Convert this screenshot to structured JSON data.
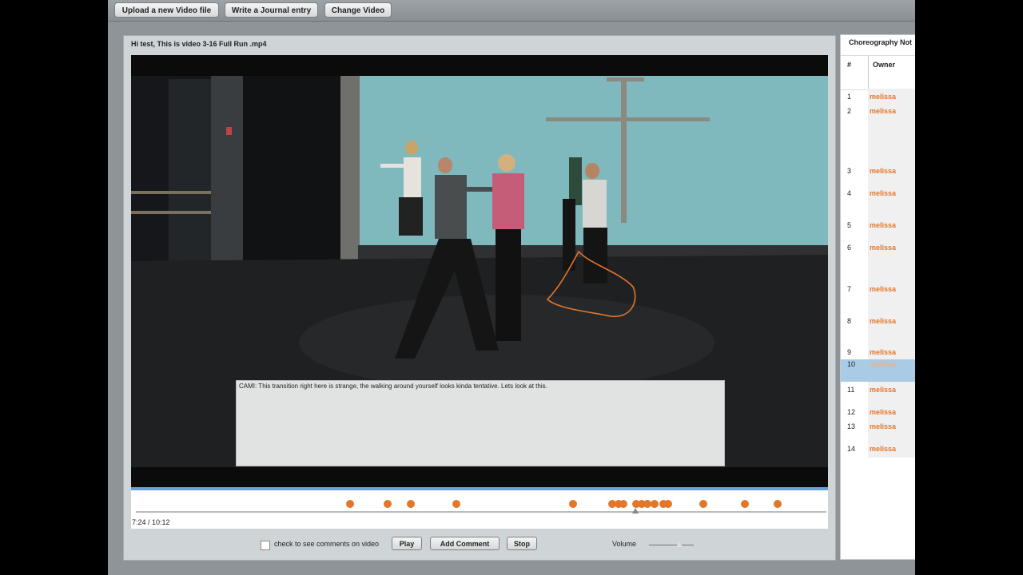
{
  "toolbar": {
    "upload_label": "Upload a new Video file",
    "journal_label": "Write a Journal entry",
    "change_label": "Change Video"
  },
  "player": {
    "greeting": "Hi test, This is video 3-16 Full Run .mp4",
    "comment": "CAMI: This transition right here is strange, the walking around yourself looks kinda tentative. Lets look at this.",
    "time": "7:24 / 10:12",
    "position_seconds": 444,
    "duration_seconds": 612,
    "marker_count": 17
  },
  "controls": {
    "checkbox_label": "check to see comments on video",
    "checkbox_checked": false,
    "play_label": "Play",
    "add_comment_label": "Add Comment",
    "stop_label": "Stop",
    "volume_label": "Volume",
    "volume_level": 0.65
  },
  "notes": {
    "title": "Choreography Not",
    "col_num": "#",
    "col_owner": "Owner",
    "selected_row": "10",
    "rows": [
      {
        "num": "1",
        "owner": "melissa"
      },
      {
        "num": "2",
        "owner": "melissa"
      },
      {
        "num": "3",
        "owner": "melissa"
      },
      {
        "num": "4",
        "owner": "melissa"
      },
      {
        "num": "5",
        "owner": "melissa"
      },
      {
        "num": "6",
        "owner": "melissa"
      },
      {
        "num": "7",
        "owner": "melissa"
      },
      {
        "num": "8",
        "owner": "melissa"
      },
      {
        "num": "9",
        "owner": "melissa"
      },
      {
        "num": "10",
        "owner": "melissa"
      },
      {
        "num": "11",
        "owner": "melissa"
      },
      {
        "num": "12",
        "owner": "melissa"
      },
      {
        "num": "13",
        "owner": "melissa"
      },
      {
        "num": "14",
        "owner": "melissa"
      }
    ]
  },
  "colors": {
    "accent": "#e4762a",
    "selection": "#a9cbe6",
    "timeline_top": "#6aa0d3"
  }
}
